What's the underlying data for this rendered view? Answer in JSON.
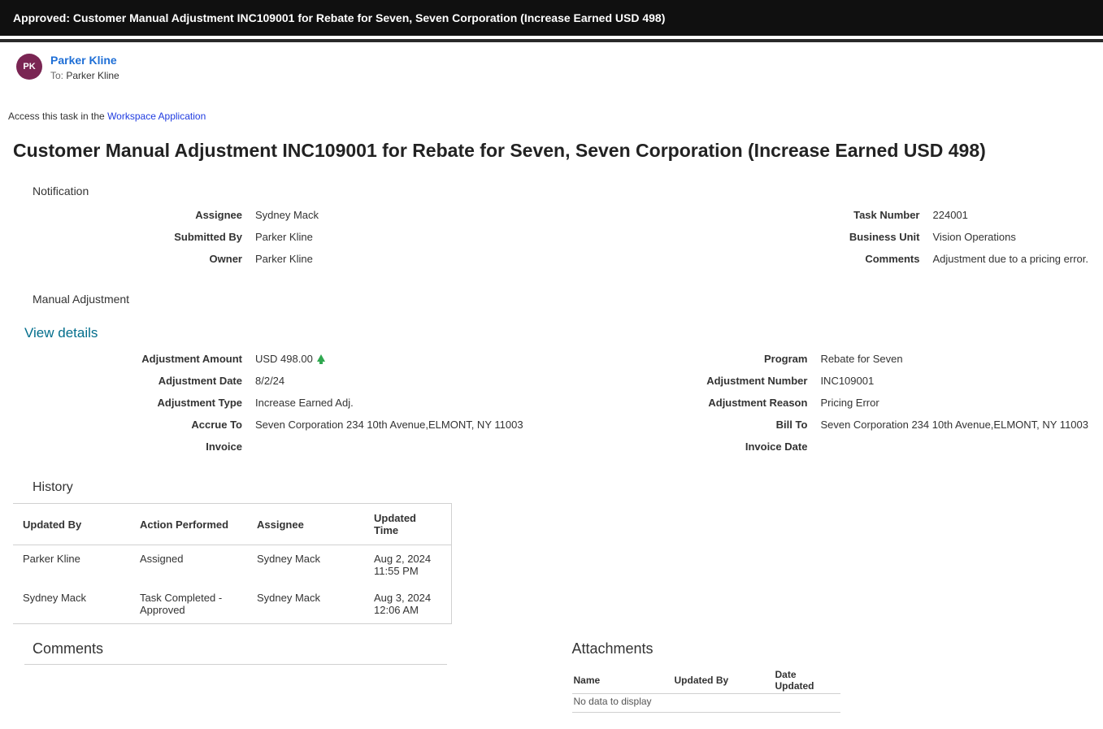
{
  "topbar": {
    "title": "Approved: Customer Manual Adjustment INC109001 for Rebate for Seven, Seven Corporation (Increase Earned USD 498)"
  },
  "email": {
    "from_initials": "PK",
    "from_name": "Parker Kline",
    "to_label": "To:",
    "to_name": "Parker Kline"
  },
  "access": {
    "prefix": "Access this task in the ",
    "link_text": "Workspace Application"
  },
  "main_title": "Customer Manual Adjustment INC109001 for Rebate for Seven, Seven Corporation (Increase Earned USD 498)",
  "sections": {
    "notification_label": "Notification",
    "manual_adj_label": "Manual Adjustment",
    "view_details_link": "View details",
    "history_label": "History",
    "comments_label": "Comments",
    "attachments_label": "Attachments"
  },
  "notification": {
    "left": {
      "assignee_label": "Assignee",
      "assignee_value": "Sydney Mack",
      "submitted_by_label": "Submitted By",
      "submitted_by_value": "Parker Kline",
      "owner_label": "Owner",
      "owner_value": "Parker Kline"
    },
    "right": {
      "task_number_label": "Task Number",
      "task_number_value": "224001",
      "business_unit_label": "Business Unit",
      "business_unit_value": "Vision Operations",
      "comments_label": "Comments",
      "comments_value": "Adjustment due to a pricing error."
    }
  },
  "adjustment": {
    "left": {
      "amount_label": "Adjustment Amount",
      "amount_value": "USD 498.00",
      "date_label": "Adjustment Date",
      "date_value": "8/2/24",
      "type_label": "Adjustment Type",
      "type_value": "Increase Earned Adj.",
      "accrue_to_label": "Accrue To",
      "accrue_to_value": "Seven Corporation 234 10th Avenue,ELMONT, NY 11003",
      "invoice_label": "Invoice",
      "invoice_value": ""
    },
    "right": {
      "program_label": "Program",
      "program_value": "Rebate for Seven",
      "adj_number_label": "Adjustment Number",
      "adj_number_value": "INC109001",
      "adj_reason_label": "Adjustment Reason",
      "adj_reason_value": "Pricing Error",
      "bill_to_label": "Bill To",
      "bill_to_value": "Seven Corporation 234 10th Avenue,ELMONT, NY 11003",
      "invoice_date_label": "Invoice Date",
      "invoice_date_value": ""
    }
  },
  "history": {
    "columns": {
      "updated_by": "Updated By",
      "action": "Action Performed",
      "assignee": "Assignee",
      "updated_time": "Updated Time"
    },
    "rows": [
      {
        "updated_by": "Parker Kline",
        "action": "Assigned",
        "assignee": "Sydney Mack",
        "updated_time": "Aug 2, 2024 11:55 PM"
      },
      {
        "updated_by": "Sydney Mack",
        "action": "Task Completed - Approved",
        "assignee": "Sydney Mack",
        "updated_time": "Aug 3, 2024 12:06 AM"
      }
    ]
  },
  "attachments": {
    "columns": {
      "name": "Name",
      "updated_by": "Updated By",
      "date_updated": "Date Updated"
    },
    "no_data": "No data to display"
  }
}
